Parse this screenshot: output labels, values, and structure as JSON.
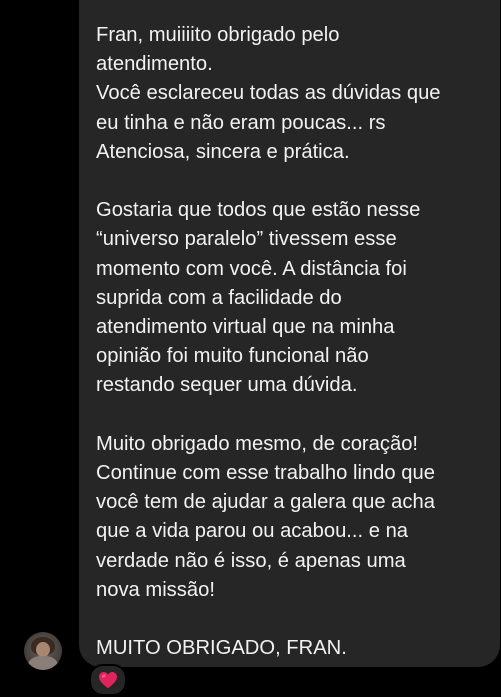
{
  "message": {
    "paragraphs": [
      "Fran, muiiiito obrigado pelo\natendimento.\nVocê esclareceu todas as dúvidas que\neu tinha e não eram poucas... rs\nAtenciosa, sincera e prática.",
      "Gostaria que todos que estão nesse\n“universo paralelo” tivessem esse\nmomento com você. A distância foi\nsuprida com a facilidade do\natendimento virtual que na minha\nopinião foi muito funcional não\nrestando sequer uma dúvida.",
      "Muito obrigado mesmo, de coração!\nContinue com esse trabalho lindo que\nvocê tem de ajudar a galera que acha\nque a vida parou ou acabou... e na\nverdade não é isso, é apenas uma\nnova missão!",
      "MUITO OBRIGADO, FRAN."
    ]
  },
  "sender": {
    "avatar_icon": "user-avatar-photo"
  },
  "reaction": {
    "icon": "red-heart-icon",
    "color": "#e0245e"
  },
  "colors": {
    "background": "#000000",
    "bubble": "#262626",
    "text": "#f2f2f2"
  }
}
